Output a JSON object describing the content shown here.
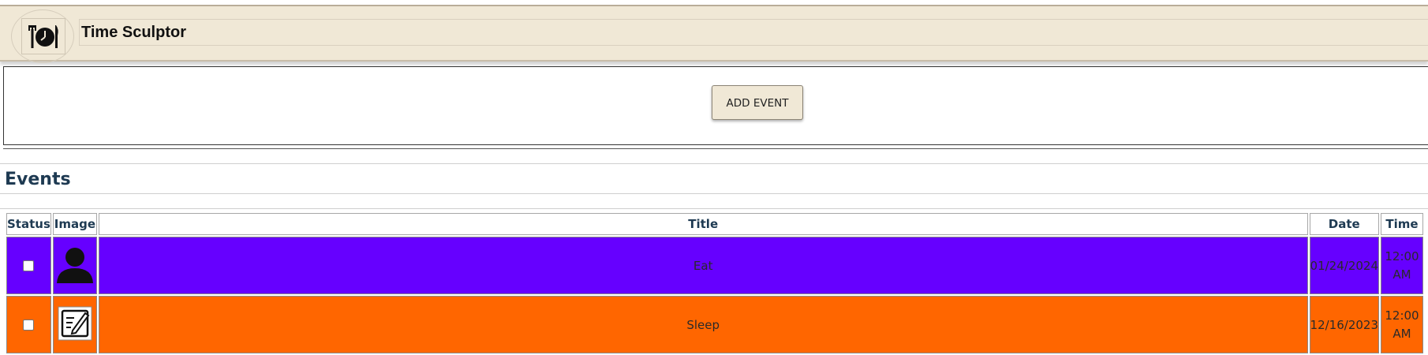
{
  "header": {
    "title": "Time Sculptor",
    "logo_icon": "clock-utensils-logo-icon"
  },
  "add_event": {
    "label": "ADD EVENT"
  },
  "events": {
    "heading": "Events",
    "columns": [
      "Status",
      "Image",
      "Title",
      "Date",
      "Time"
    ],
    "rows": [
      {
        "status_checked": false,
        "image_icon": "person-icon",
        "title": "Eat",
        "date": "01/24/2024",
        "time_line1": "12:00",
        "time_line2": "AM",
        "row_color": "#6600ff"
      },
      {
        "status_checked": false,
        "image_icon": "edit-note-icon",
        "title": "Sleep",
        "date": "12/16/2023",
        "time_line1": "12:00",
        "time_line2": "AM",
        "row_color": "#ff6600"
      }
    ]
  },
  "colors": {
    "header_bg": "#f0e8d6",
    "heading_text": "#1e3a52",
    "eat_row": "#6600ff",
    "sleep_row": "#ff6600"
  }
}
